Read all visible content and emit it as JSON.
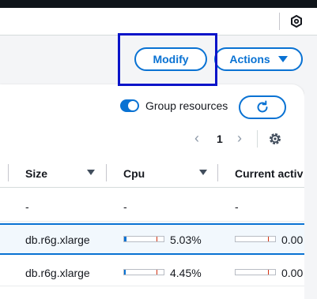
{
  "toolbar": {
    "modify_label": "Modify",
    "actions_label": "Actions"
  },
  "table_controls": {
    "group_resources_label": "Group resources",
    "group_resources_on": true,
    "page": "1"
  },
  "columns": [
    {
      "label": "Size"
    },
    {
      "label": "Cpu"
    },
    {
      "label": "Current activ"
    }
  ],
  "rows": [
    {
      "size": "-",
      "cpu_text": "-",
      "cpu_fraction": null,
      "activity_text": "-",
      "activity_fraction": null
    },
    {
      "size": "db.r6g.xlarge",
      "cpu_text": "5.03%",
      "cpu_fraction": 0.0503,
      "activity_text": "0.00",
      "activity_fraction": 0.0,
      "selected": true
    },
    {
      "size": "db.r6g.xlarge",
      "cpu_text": "4.45%",
      "cpu_fraction": 0.0445,
      "activity_text": "0.00",
      "activity_fraction": 0.0
    }
  ],
  "colors": {
    "accent": "#0972d3",
    "highlight_box": "#0a14c9"
  }
}
